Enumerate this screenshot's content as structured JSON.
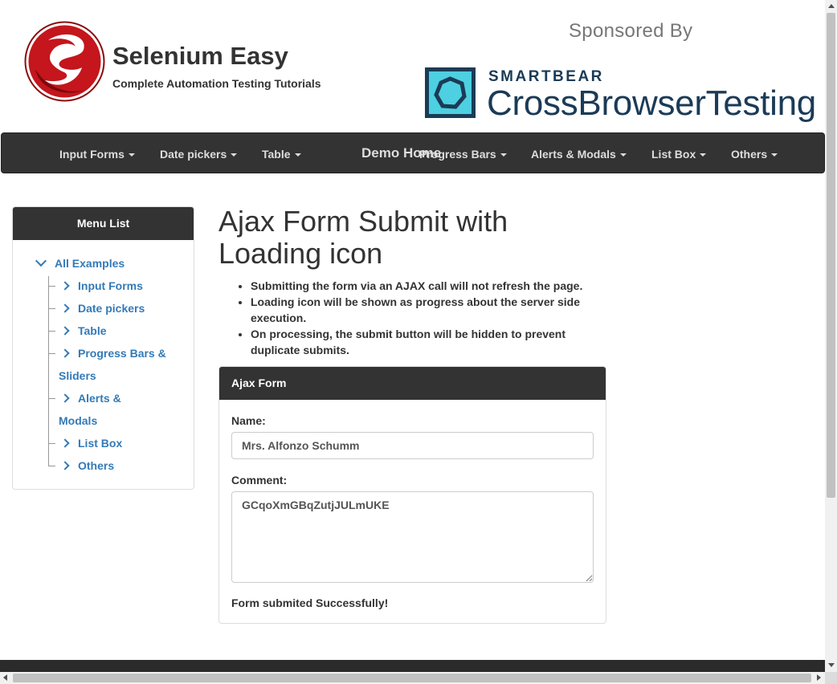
{
  "header": {
    "brand_title": "Selenium Easy",
    "brand_subtitle": "Complete Automation Testing Tutorials",
    "sponsored_by": "Sponsored By",
    "sponsor_word": "SMARTBEAR",
    "sponsor_product": "CrossBrowserTesting"
  },
  "navbar": {
    "items": [
      "Input Forms",
      "Date pickers",
      "Table",
      "Progress Bars",
      "Alerts & Modals",
      "List Box",
      "Others"
    ],
    "home": "Demo Home"
  },
  "sidebar": {
    "title": "Menu List",
    "root": "All Examples",
    "items": [
      "Input Forms",
      "Date pickers",
      "Table",
      "Progress Bars & Sliders",
      "Alerts & Modals",
      "List Box",
      "Others"
    ]
  },
  "main": {
    "title": "Ajax Form Submit with Loading icon",
    "bullets": [
      "Submitting the form via an AJAX call will not refresh the page.",
      "Loading icon will be shown as progress about the server side execution.",
      "On processing, the submit button will be hidden to prevent duplicate submits."
    ],
    "panel": {
      "title": "Ajax Form",
      "name_label": "Name:",
      "name_value": "Mrs. Alfonzo Schumm",
      "comment_label": "Comment:",
      "comment_value": "GCqoXmGBqZutjJULmUKE",
      "status": "Form submited Successfully!"
    }
  },
  "colors": {
    "navbar_bg": "#333333",
    "link": "#337ab7",
    "logo_red": "#c4161c",
    "sponsor_teal": "#4dd0e1",
    "sponsor_navy": "#1b3b57"
  }
}
